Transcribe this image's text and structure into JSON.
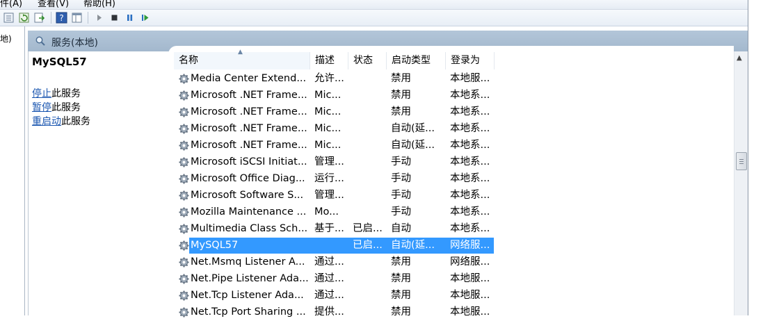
{
  "menu": {
    "items": [
      "件(A)",
      "查看(V)",
      "帮助(H)"
    ]
  },
  "toolbar": {
    "icons": [
      "console-tree-icon",
      "properties-icon",
      "refresh-icon",
      "export-icon",
      "help-icon",
      "view-icon",
      "start-icon",
      "stop-icon",
      "pause-icon",
      "restart-icon"
    ]
  },
  "left_strip": {
    "text": "地)"
  },
  "panel": {
    "title": "服务(本地)"
  },
  "detail": {
    "service_name": "MySQL57",
    "actions": [
      {
        "link": "停止",
        "suffix": "此服务"
      },
      {
        "link": "暂停",
        "suffix": "此服务"
      },
      {
        "link": "重启动",
        "suffix": "此服务"
      }
    ]
  },
  "columns": [
    "名称",
    "描述",
    "状态",
    "启动类型",
    "登录为"
  ],
  "services": [
    {
      "name": "Media Center Extend...",
      "desc": "允许...",
      "status": "",
      "start": "禁用",
      "logon": "本地服..."
    },
    {
      "name": "Microsoft .NET Frame...",
      "desc": "Mic...",
      "status": "",
      "start": "禁用",
      "logon": "本地系..."
    },
    {
      "name": "Microsoft .NET Frame...",
      "desc": "Mic...",
      "status": "",
      "start": "禁用",
      "logon": "本地系..."
    },
    {
      "name": "Microsoft .NET Frame...",
      "desc": "Mic...",
      "status": "",
      "start": "自动(延...",
      "logon": "本地系..."
    },
    {
      "name": "Microsoft .NET Frame...",
      "desc": "Mic...",
      "status": "",
      "start": "自动(延...",
      "logon": "本地系..."
    },
    {
      "name": "Microsoft iSCSI Initiat...",
      "desc": "管理...",
      "status": "",
      "start": "手动",
      "logon": "本地系..."
    },
    {
      "name": "Microsoft Office Diag...",
      "desc": "运行...",
      "status": "",
      "start": "手动",
      "logon": "本地系..."
    },
    {
      "name": "Microsoft Software S...",
      "desc": "管理...",
      "status": "",
      "start": "手动",
      "logon": "本地系..."
    },
    {
      "name": "Mozilla Maintenance ...",
      "desc": "Mo...",
      "status": "",
      "start": "手动",
      "logon": "本地系..."
    },
    {
      "name": "Multimedia Class Sch...",
      "desc": "基于...",
      "status": "已启...",
      "start": "自动",
      "logon": "本地系..."
    },
    {
      "name": "MySQL57",
      "desc": "",
      "status": "已启...",
      "start": "自动(延...",
      "logon": "网络服..."
    },
    {
      "name": "Net.Msmq Listener A...",
      "desc": "通过...",
      "status": "",
      "start": "禁用",
      "logon": "网络服..."
    },
    {
      "name": "Net.Pipe Listener Ada...",
      "desc": "通过...",
      "status": "",
      "start": "禁用",
      "logon": "本地服..."
    },
    {
      "name": "Net.Tcp Listener Ada...",
      "desc": "通过...",
      "status": "",
      "start": "禁用",
      "logon": "本地服..."
    },
    {
      "name": "Net.Tcp Port Sharing ...",
      "desc": "提供...",
      "status": "",
      "start": "禁用",
      "logon": "本地服..."
    }
  ],
  "selected_service": "MySQL57",
  "colors": {
    "selection": "#3399ff",
    "header": "#a9bdd1",
    "link": "#1a56b0"
  }
}
